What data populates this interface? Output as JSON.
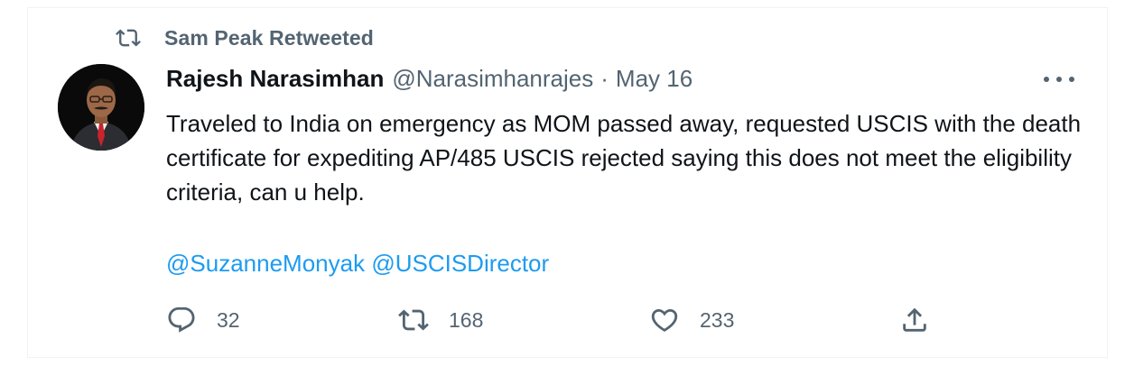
{
  "retweet_banner": {
    "text": "Sam Peak Retweeted",
    "icon": "retweet-icon"
  },
  "author": {
    "display_name": "Rajesh Narasimhan",
    "handle": "@Narasimhanrajes",
    "separator": "·",
    "date": "May 16",
    "avatar": "avatar-photo"
  },
  "tweet": {
    "text": "Traveled to India on emergency as MOM passed away, requested USCIS with the death certificate for expediting AP/485 USCIS rejected saying this does not meet the eligibility criteria, can u help.",
    "mentions": [
      "@SuzanneMonyak",
      "@USCISDirector"
    ]
  },
  "actions": {
    "reply": {
      "icon": "reply-icon",
      "count": "32"
    },
    "retweet": {
      "icon": "retweet-icon",
      "count": "168"
    },
    "like": {
      "icon": "heart-icon",
      "count": "233"
    },
    "share": {
      "icon": "share-icon"
    }
  },
  "more_menu": {
    "icon": "more-horizontal-icon"
  },
  "colors": {
    "text_primary": "#0f1419",
    "text_secondary": "#536471",
    "link": "#1d9bf0",
    "border": "#eff3f4"
  }
}
